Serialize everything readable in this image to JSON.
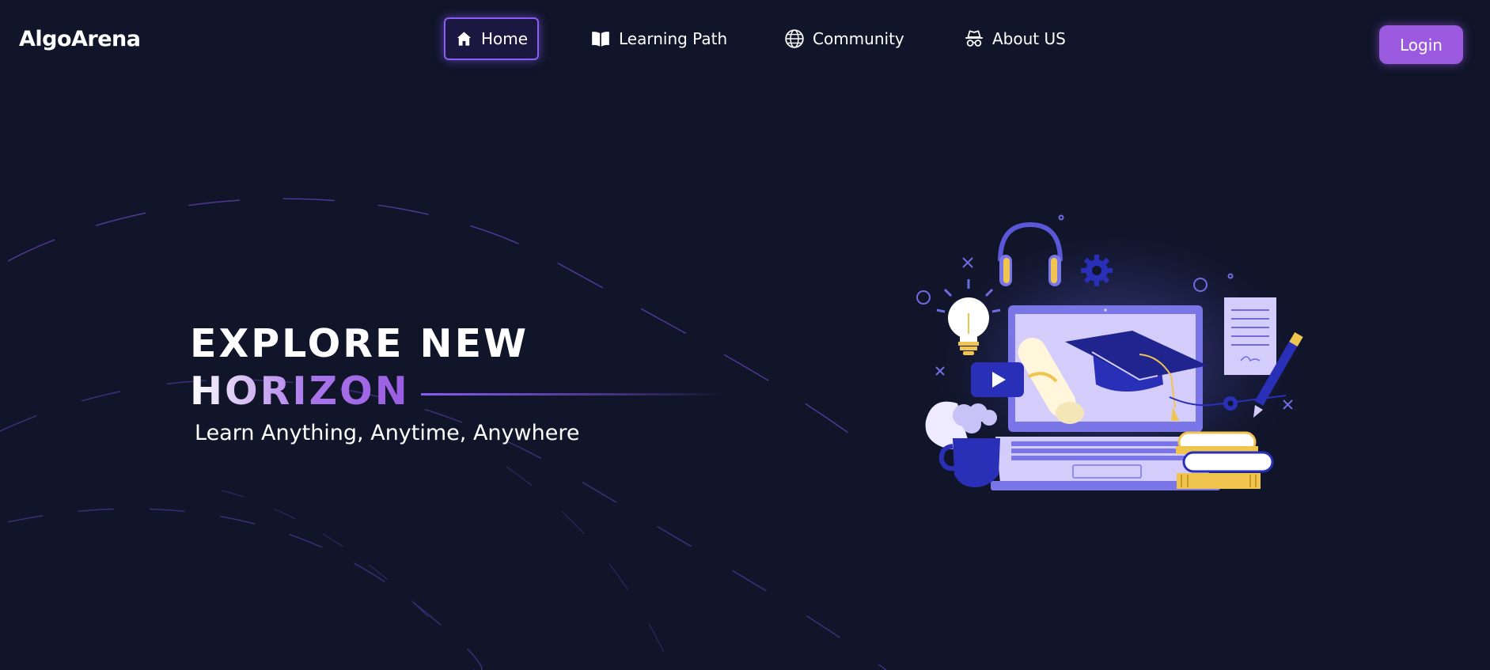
{
  "brand": {
    "name": "AlgoArena"
  },
  "nav": {
    "items": [
      {
        "label": "Home",
        "icon": "home-icon",
        "active": true
      },
      {
        "label": "Learning Path",
        "icon": "book-open-icon",
        "active": false
      },
      {
        "label": "Community",
        "icon": "globe-icon",
        "active": false
      },
      {
        "label": "About US",
        "icon": "incognito-icon",
        "active": false
      }
    ],
    "login_label": "Login"
  },
  "hero": {
    "title_line1": "EXPLORE NEW",
    "title_line2": "HORIZON",
    "subtitle": "Learn Anything, Anytime, Anywhere"
  },
  "illustration": {
    "name": "online-education-illustration"
  },
  "colors": {
    "background": "#10152a",
    "accent": "#9b59e0",
    "accent_glow": "#8b5cf6",
    "illustration_blue": "#2a2fb8",
    "illustration_lavender": "#d4ccfa",
    "illustration_gold": "#efc44f"
  }
}
